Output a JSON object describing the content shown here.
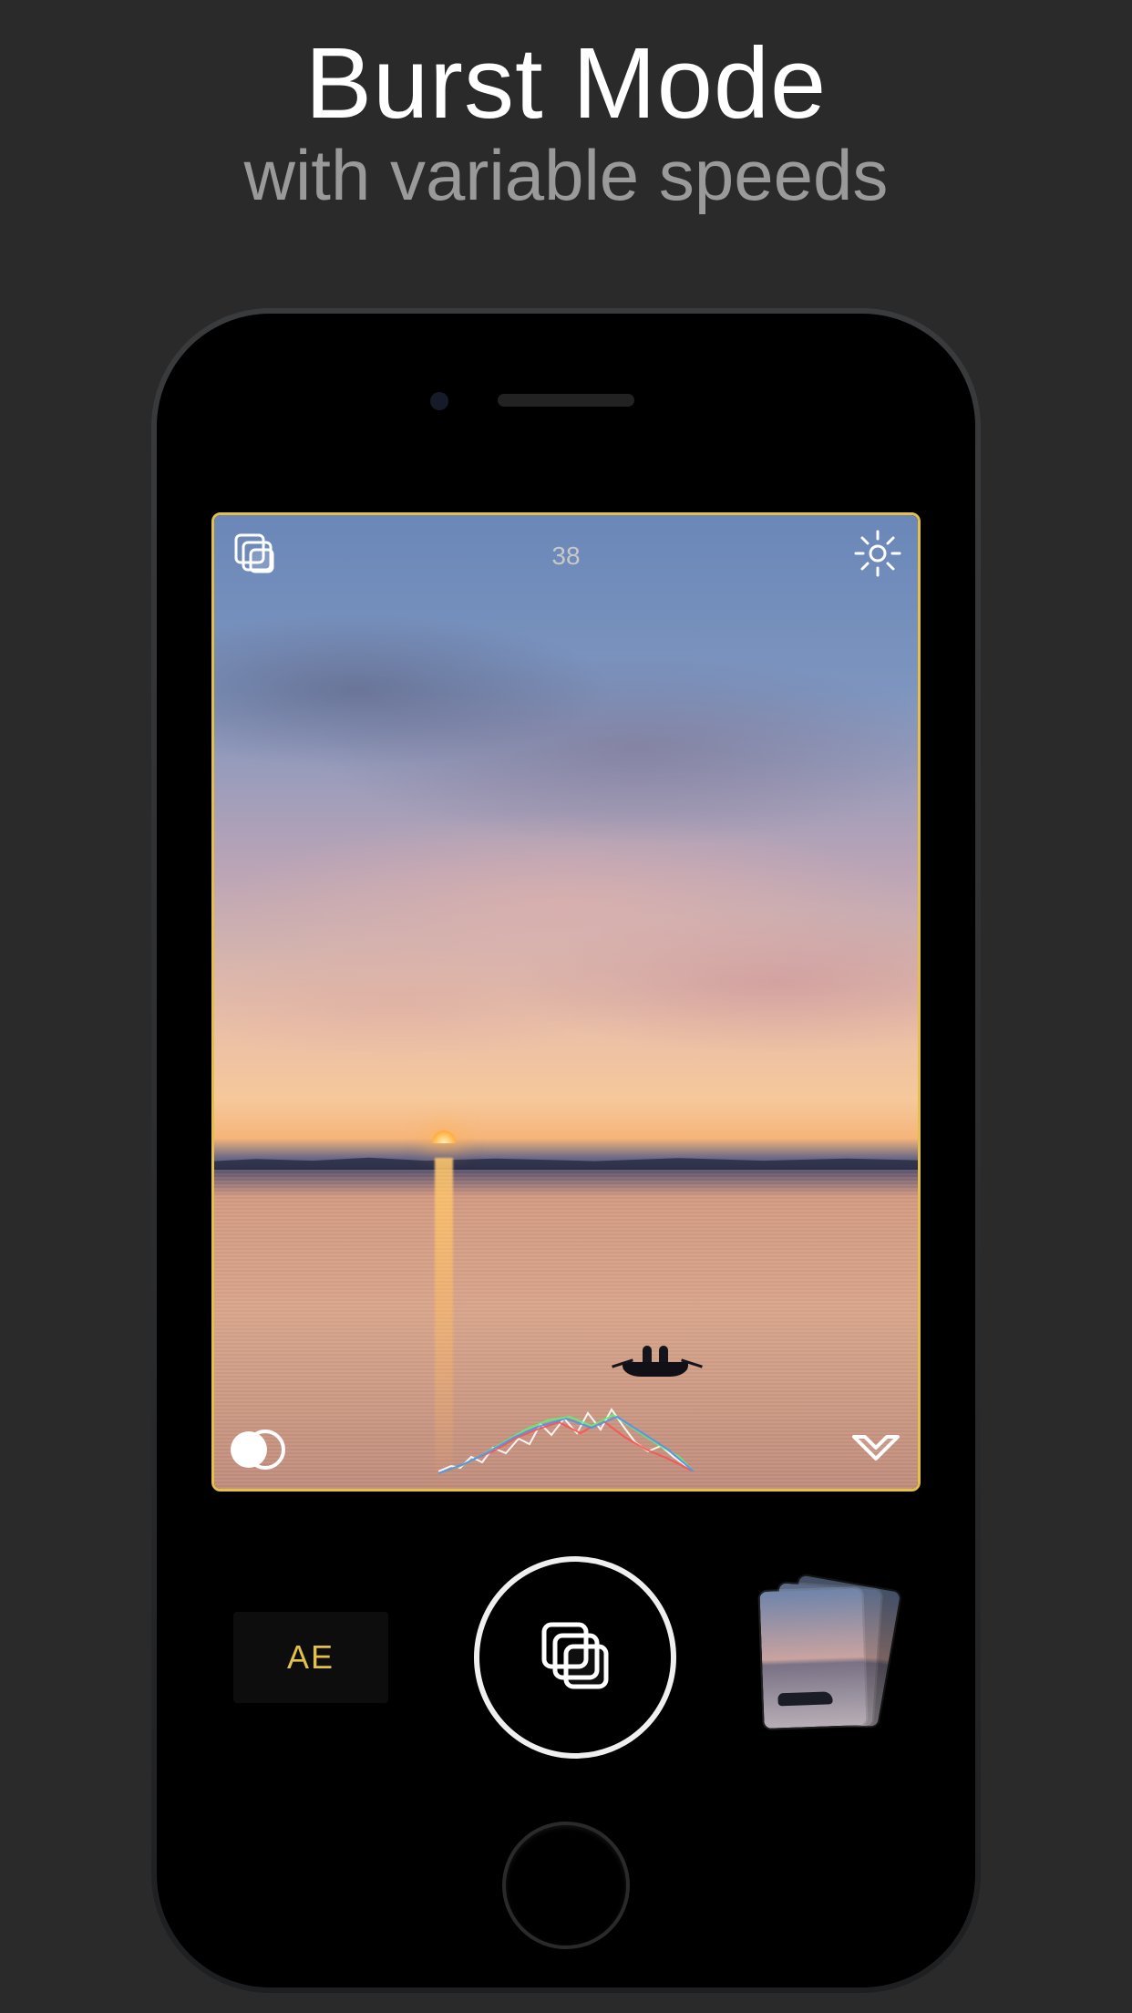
{
  "marketing": {
    "headline": "Burst Mode",
    "subhead": "with variable speeds"
  },
  "viewfinder": {
    "frame_count": "38",
    "icons": {
      "burst": "burst-icon",
      "settings": "gear-icon",
      "overlap": "overlap-circles-icon",
      "chevron": "chevron-down-outline-icon",
      "histogram": "rgb-histogram"
    }
  },
  "controls": {
    "ae_label": "AE",
    "shutter_icon": "burst-icon",
    "thumbnail_label": "recent-photos"
  },
  "colors": {
    "accent_yellow": "#e2c04a",
    "viewfinder_border": "#e2c04a"
  }
}
